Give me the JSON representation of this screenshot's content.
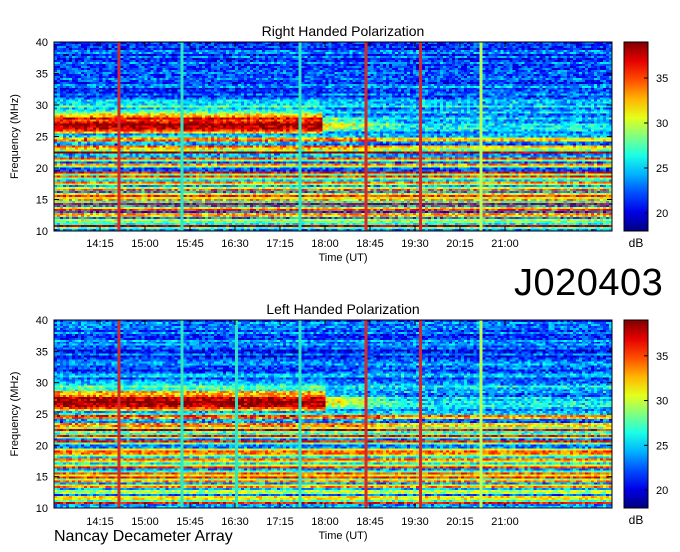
{
  "figure": {
    "observation_id": "J020403",
    "instrument": "Nancay Decameter Array"
  },
  "chart_data": [
    {
      "type": "heatmap",
      "title": "Right Handed Polarization",
      "xlabel": "Time (UT)",
      "ylabel": "Frequency (MHz)",
      "x_ticks": [
        "14:15",
        "15:00",
        "15:45",
        "16:30",
        "17:15",
        "18:00",
        "18:45",
        "19:30",
        "20:15",
        "21:00"
      ],
      "y_ticks": [
        10,
        15,
        20,
        25,
        30,
        35,
        40
      ],
      "ylim": [
        10,
        40
      ],
      "colorbar": {
        "label": "dB",
        "ticks": [
          20,
          25,
          30,
          35
        ],
        "range": [
          18,
          39
        ]
      },
      "emission": {
        "band_mhz": [
          25.5,
          28.5
        ],
        "ends_at": "17:55",
        "secondary_band_mhz": [
          22,
          25
        ]
      },
      "interference_bands_mhz": [
        10.8,
        11.6,
        12.5,
        13.4,
        14.3,
        15.0,
        15.6,
        16.6,
        17.6,
        18.6,
        19.2,
        20.5,
        21.5,
        22.5,
        23.3,
        24.5
      ],
      "vertical_marks": [
        {
          "time": "14:33",
          "color": "#d42a2a"
        },
        {
          "time": "15:37",
          "color": "#2ee6c0"
        },
        {
          "time": "17:32",
          "color": "#2ee6c0"
        },
        {
          "time": "18:40",
          "color": "#d42a2a"
        },
        {
          "time": "19:33",
          "color": "#d42a2a"
        },
        {
          "time": "20:34",
          "color": "#b8ff5a"
        }
      ]
    },
    {
      "type": "heatmap",
      "title": "Left Handed Polarization",
      "xlabel": "Time (UT)",
      "ylabel": "Frequency (MHz)",
      "x_ticks": [
        "14:15",
        "15:00",
        "15:45",
        "16:30",
        "17:15",
        "18:00",
        "18:45",
        "19:30",
        "20:15",
        "21:00"
      ],
      "y_ticks": [
        10,
        15,
        20,
        25,
        30,
        35,
        40
      ],
      "ylim": [
        10,
        40
      ],
      "colorbar": {
        "label": "dB",
        "ticks": [
          20,
          25,
          30,
          35
        ],
        "range": [
          18,
          39
        ]
      },
      "emission": {
        "band_mhz": [
          25.5,
          28.5
        ],
        "ends_at": "18:00",
        "secondary_band_mhz": [
          22,
          25
        ]
      },
      "interference_bands_mhz": [
        10.8,
        11.6,
        12.5,
        13.4,
        14.3,
        15.0,
        15.6,
        16.6,
        17.6,
        18.6,
        19.2,
        20.5,
        21.5,
        22.5,
        23.3,
        24.5
      ],
      "vertical_marks": [
        {
          "time": "14:33",
          "color": "#d42a2a"
        },
        {
          "time": "15:37",
          "color": "#2ee6c0"
        },
        {
          "time": "16:30",
          "color": "#2ee6c0"
        },
        {
          "time": "17:32",
          "color": "#2ee6c0"
        },
        {
          "time": "18:40",
          "color": "#d42a2a"
        },
        {
          "time": "19:33",
          "color": "#d42a2a"
        },
        {
          "time": "20:34",
          "color": "#b8ff5a"
        }
      ]
    }
  ]
}
